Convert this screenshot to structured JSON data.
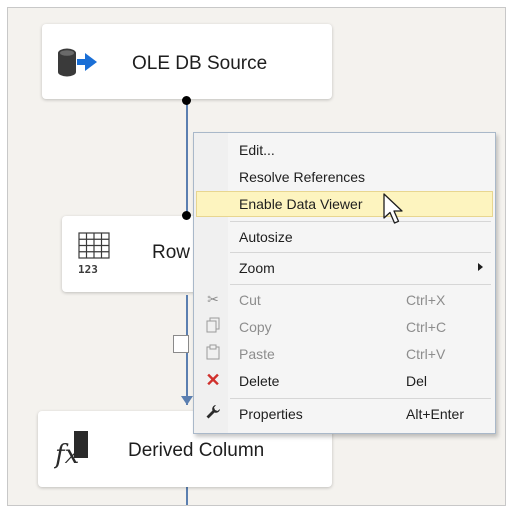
{
  "nodes": {
    "ole_source": {
      "label": "OLE DB Source",
      "icon": "database-arrow-icon"
    },
    "row_count": {
      "label": "Row",
      "icon": "grid-123-icon"
    },
    "derived_column": {
      "label": "Derived Column",
      "icon": "fx-icon"
    }
  },
  "context_menu": {
    "items": [
      {
        "label": "Edit...",
        "shortcut": ""
      },
      {
        "label": "Resolve References",
        "shortcut": ""
      },
      {
        "label": "Enable Data Viewer",
        "shortcut": "",
        "highlighted": true
      },
      {
        "label": "Autosize",
        "shortcut": ""
      },
      {
        "label": "Zoom",
        "shortcut": "",
        "submenu": true
      },
      {
        "label": "Cut",
        "shortcut": "Ctrl+X",
        "disabled": true,
        "icon": "scissors-icon"
      },
      {
        "label": "Copy",
        "shortcut": "Ctrl+C",
        "disabled": true,
        "icon": "copy-icon"
      },
      {
        "label": "Paste",
        "shortcut": "Ctrl+V",
        "disabled": true,
        "icon": "paste-icon"
      },
      {
        "label": "Delete",
        "shortcut": "Del",
        "icon": "delete-x-icon"
      },
      {
        "label": "Properties",
        "shortcut": "Alt+Enter",
        "icon": "wrench-icon"
      }
    ]
  },
  "colors": {
    "canvas": "#f4f2ee",
    "path": "#5b7fb0",
    "menu_highlight": "#fdf4bf",
    "delete_icon": "#d0312d",
    "database_icon": "#3a3a3a",
    "arrow_icon": "#1a6fd6"
  }
}
